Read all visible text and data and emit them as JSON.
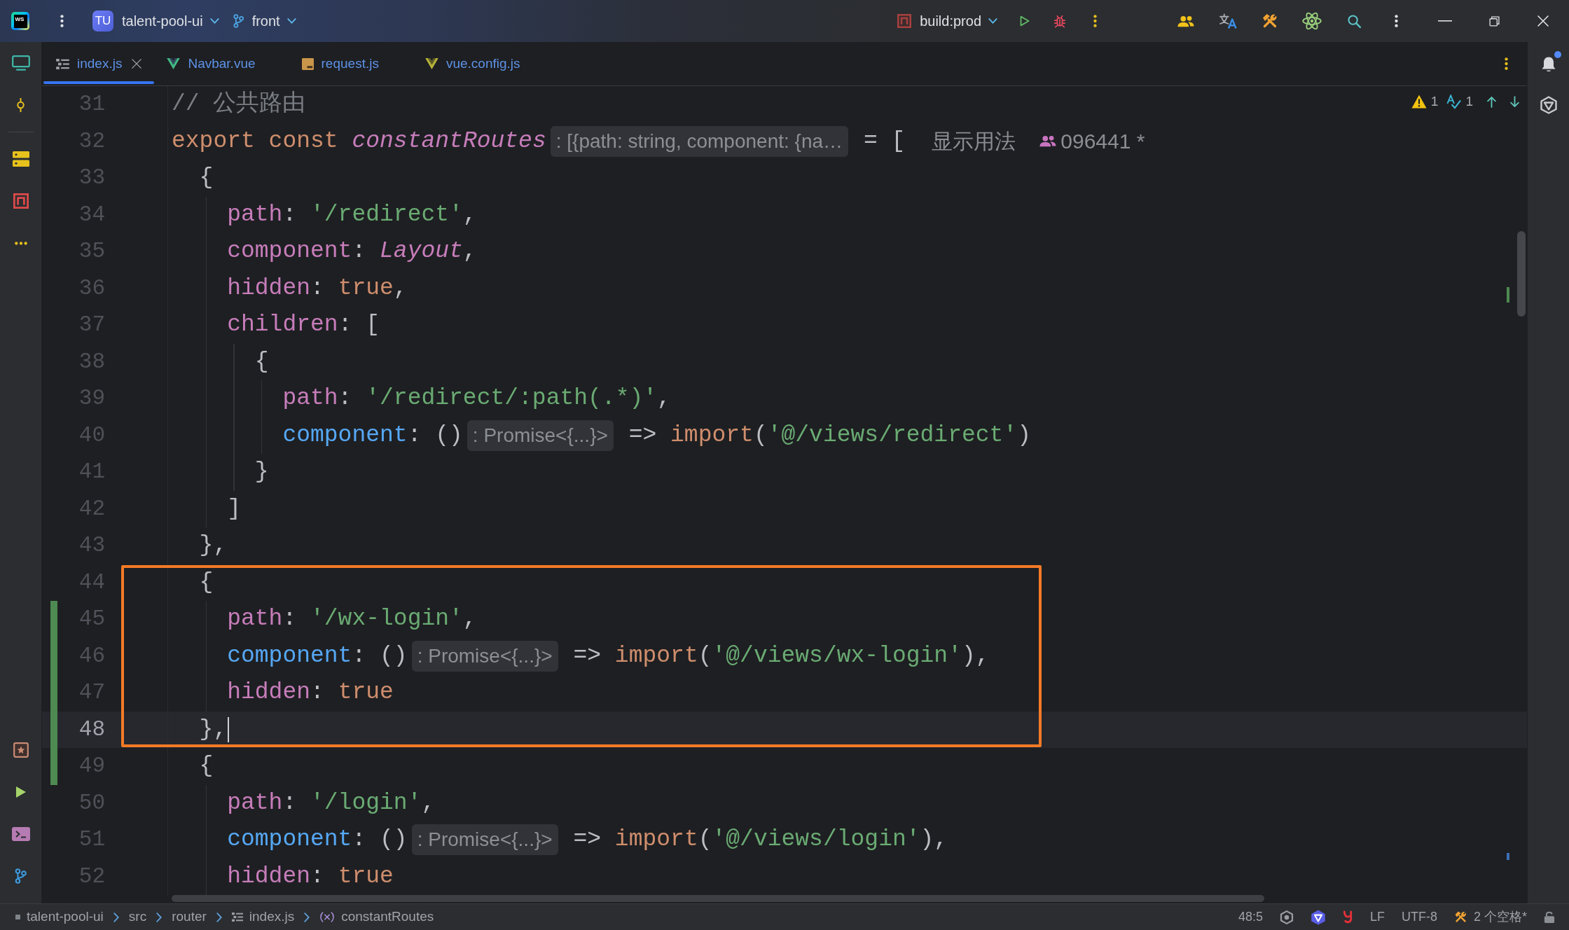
{
  "title_bar": {
    "logo": "WS",
    "project_badge": "TU",
    "project": "talent-pool-ui",
    "branch": "front",
    "run_configuration": "build:prod"
  },
  "tabs": [
    {
      "kind": "structure",
      "label": "index.js",
      "selected": true
    },
    {
      "kind": "vue",
      "label": "Navbar.vue",
      "selected": false
    },
    {
      "kind": "script",
      "label": "request.js",
      "selected": false
    },
    {
      "kind": "config",
      "label": "vue.config.js",
      "selected": false
    }
  ],
  "editor": {
    "inspections": {
      "warnings": "1",
      "typos": "1"
    },
    "blocks": [
      {
        "boxed": false,
        "lines": [
          {
            "number": "31",
            "current": false,
            "changed": false,
            "tokens": [
              {
                "kind": "comment",
                "text": "// 公共路由"
              }
            ]
          },
          {
            "number": "32",
            "current": false,
            "changed": false,
            "tokens": [
              {
                "kind": "keyword",
                "text": "export const "
              },
              {
                "kind": "global",
                "text": "constantRoutes"
              },
              {
                "kind": "hint",
                "text": ": [{path: string, component: {na…"
              },
              {
                "kind": "plain",
                "text": " = ["
              },
              {
                "kind": "usages",
                "text": "显示用法"
              },
              {
                "kind": "author",
                "text": "096441 *"
              }
            ]
          },
          {
            "number": "33",
            "current": false,
            "changed": false,
            "tokens": [
              {
                "kind": "plain",
                "text": "  {"
              }
            ]
          },
          {
            "number": "34",
            "current": false,
            "changed": false,
            "tokens": [
              {
                "kind": "property",
                "text": "    path"
              },
              {
                "kind": "plain",
                "text": ": "
              },
              {
                "kind": "string",
                "text": "'/redirect'"
              },
              {
                "kind": "plain",
                "text": ","
              }
            ]
          },
          {
            "number": "35",
            "current": false,
            "changed": false,
            "tokens": [
              {
                "kind": "property",
                "text": "    component"
              },
              {
                "kind": "plain",
                "text": ": "
              },
              {
                "kind": "global",
                "text": "Layout"
              },
              {
                "kind": "plain",
                "text": ","
              }
            ]
          },
          {
            "number": "36",
            "current": false,
            "changed": false,
            "tokens": [
              {
                "kind": "property",
                "text": "    hidden"
              },
              {
                "kind": "plain",
                "text": ": "
              },
              {
                "kind": "keyword",
                "text": "true"
              },
              {
                "kind": "plain",
                "text": ","
              }
            ]
          },
          {
            "number": "37",
            "current": false,
            "changed": false,
            "tokens": [
              {
                "kind": "property",
                "text": "    children"
              },
              {
                "kind": "plain",
                "text": ": ["
              }
            ]
          },
          {
            "number": "38",
            "current": false,
            "changed": false,
            "tokens": [
              {
                "kind": "plain",
                "text": "      {"
              }
            ]
          },
          {
            "number": "39",
            "current": false,
            "changed": false,
            "tokens": [
              {
                "kind": "property",
                "text": "        path"
              },
              {
                "kind": "plain",
                "text": ": "
              },
              {
                "kind": "string",
                "text": "'/redirect/:path(.*)'"
              },
              {
                "kind": "plain",
                "text": ","
              }
            ]
          },
          {
            "number": "40",
            "current": false,
            "changed": false,
            "tokens": [
              {
                "kind": "method",
                "text": "        component"
              },
              {
                "kind": "plain",
                "text": ": ()"
              },
              {
                "kind": "hint",
                "text": ": Promise<{...}>"
              },
              {
                "kind": "plain",
                "text": " => "
              },
              {
                "kind": "keyword",
                "text": "import"
              },
              {
                "kind": "plain",
                "text": "("
              },
              {
                "kind": "string",
                "text": "'@/views/redirect'"
              },
              {
                "kind": "plain",
                "text": ")"
              }
            ]
          },
          {
            "number": "41",
            "current": false,
            "changed": false,
            "tokens": [
              {
                "kind": "plain",
                "text": "      }"
              }
            ]
          },
          {
            "number": "42",
            "current": false,
            "changed": false,
            "tokens": [
              {
                "kind": "plain",
                "text": "    ]"
              }
            ]
          },
          {
            "number": "43",
            "current": false,
            "changed": false,
            "tokens": [
              {
                "kind": "plain",
                "text": "  },"
              }
            ]
          }
        ]
      },
      {
        "boxed": true,
        "lines": [
          {
            "number": "44",
            "current": false,
            "changed": false,
            "tokens": [
              {
                "kind": "plain",
                "text": "  {"
              }
            ]
          },
          {
            "number": "45",
            "current": false,
            "changed": true,
            "tokens": [
              {
                "kind": "property",
                "text": "    path"
              },
              {
                "kind": "plain",
                "text": ": "
              },
              {
                "kind": "string",
                "text": "'/wx-login'"
              },
              {
                "kind": "plain",
                "text": ","
              }
            ]
          },
          {
            "number": "46",
            "current": false,
            "changed": true,
            "tokens": [
              {
                "kind": "method",
                "text": "    component"
              },
              {
                "kind": "plain",
                "text": ": ()"
              },
              {
                "kind": "hint",
                "text": ": Promise<{...}>"
              },
              {
                "kind": "plain",
                "text": " => "
              },
              {
                "kind": "keyword",
                "text": "import"
              },
              {
                "kind": "plain",
                "text": "("
              },
              {
                "kind": "string",
                "text": "'@/views/wx-login'"
              },
              {
                "kind": "plain",
                "text": "),"
              }
            ]
          },
          {
            "number": "47",
            "current": false,
            "changed": true,
            "tokens": [
              {
                "kind": "property",
                "text": "    hidden"
              },
              {
                "kind": "plain",
                "text": ": "
              },
              {
                "kind": "keyword",
                "text": "true"
              }
            ]
          },
          {
            "number": "48",
            "current": true,
            "changed": true,
            "tokens": [
              {
                "kind": "plain",
                "text": "  },"
              }
            ]
          }
        ]
      },
      {
        "boxed": false,
        "lines": [
          {
            "number": "49",
            "current": false,
            "changed": true,
            "tokens": [
              {
                "kind": "plain",
                "text": "  {"
              }
            ]
          },
          {
            "number": "50",
            "current": false,
            "changed": false,
            "tokens": [
              {
                "kind": "property",
                "text": "    path"
              },
              {
                "kind": "plain",
                "text": ": "
              },
              {
                "kind": "string",
                "text": "'/login'"
              },
              {
                "kind": "plain",
                "text": ","
              }
            ]
          },
          {
            "number": "51",
            "current": false,
            "changed": false,
            "tokens": [
              {
                "kind": "method",
                "text": "    component"
              },
              {
                "kind": "plain",
                "text": ": ()"
              },
              {
                "kind": "hint",
                "text": ": Promise<{...}>"
              },
              {
                "kind": "plain",
                "text": " => "
              },
              {
                "kind": "keyword",
                "text": "import"
              },
              {
                "kind": "plain",
                "text": "("
              },
              {
                "kind": "string",
                "text": "'@/views/login'"
              },
              {
                "kind": "plain",
                "text": "),"
              }
            ]
          },
          {
            "number": "52",
            "current": false,
            "changed": false,
            "tokens": [
              {
                "kind": "property",
                "text": "    hidden"
              },
              {
                "kind": "plain",
                "text": ": "
              },
              {
                "kind": "keyword",
                "text": "true"
              }
            ]
          }
        ]
      }
    ]
  },
  "breadcrumbs": [
    {
      "kind": "module",
      "label": "talent-pool-ui"
    },
    {
      "kind": "folder",
      "label": "src"
    },
    {
      "kind": "folder",
      "label": "router"
    },
    {
      "kind": "file",
      "label": "index.js"
    },
    {
      "kind": "variable",
      "label": "constantRoutes"
    }
  ],
  "status_bar": {
    "caret_position": "48:5",
    "line_separator": "LF",
    "encoding": "UTF-8",
    "indent": "2 个空格*"
  }
}
